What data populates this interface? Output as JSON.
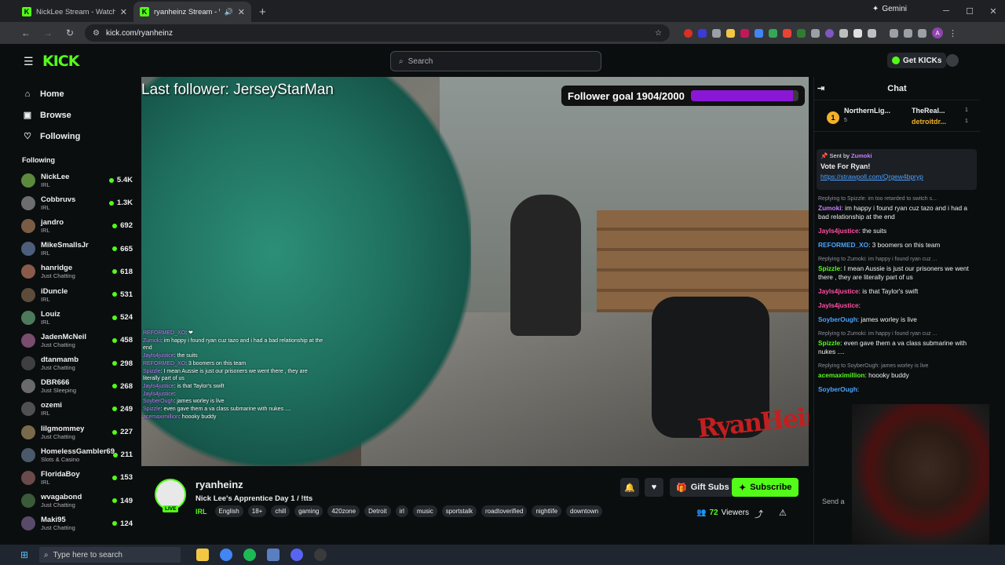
{
  "browser": {
    "tabs": [
      {
        "title": "NickLee Stream - Watch Live on",
        "active": false
      },
      {
        "title": "ryanheinz Stream - Watch L",
        "active": true
      }
    ],
    "gemini_label": "Gemini",
    "url": "kick.com/ryanheinz"
  },
  "header": {
    "logo": "KICK",
    "search_placeholder": "Search",
    "get_kicks": "Get KICKs"
  },
  "sidebar": {
    "nav": [
      {
        "label": "Home",
        "icon": "home-icon"
      },
      {
        "label": "Browse",
        "icon": "browse-icon"
      },
      {
        "label": "Following",
        "icon": "heart-icon"
      }
    ],
    "following_title": "Following",
    "channels": [
      {
        "name": "NickLee",
        "category": "IRL",
        "viewers": "5.4K"
      },
      {
        "name": "Cobbruvs",
        "category": "IRL",
        "viewers": "1.3K"
      },
      {
        "name": "jandro",
        "category": "IRL",
        "viewers": "692"
      },
      {
        "name": "MikeSmallsJr",
        "category": "IRL",
        "viewers": "665"
      },
      {
        "name": "hanridge",
        "category": "Just Chatting",
        "viewers": "618"
      },
      {
        "name": "iDuncle",
        "category": "IRL",
        "viewers": "531"
      },
      {
        "name": "Louiz",
        "category": "IRL",
        "viewers": "524"
      },
      {
        "name": "JadenMcNeil",
        "category": "Just Chatting",
        "viewers": "458"
      },
      {
        "name": "dtanmamb",
        "category": "Just Chatting",
        "viewers": "298"
      },
      {
        "name": "DBR666",
        "category": "Just Sleeping",
        "viewers": "268"
      },
      {
        "name": "ozemi",
        "category": "IRL",
        "viewers": "249"
      },
      {
        "name": "lilgmommey",
        "category": "Just Chatting",
        "viewers": "227"
      },
      {
        "name": "HomelessGambler69",
        "category": "Slots & Casino",
        "viewers": "211"
      },
      {
        "name": "FloridaBoy",
        "category": "IRL",
        "viewers": "153"
      },
      {
        "name": "wvagabond",
        "category": "Just Chatting",
        "viewers": "149"
      },
      {
        "name": "Maki95",
        "category": "Just Chatting",
        "viewers": "124"
      }
    ]
  },
  "video": {
    "last_follower": "Last follower: JerseyStarMan",
    "follower_goal": "Follower goal 1904/2000",
    "goal_progress": 0.952,
    "watermark": "RyanHeinz",
    "overlay_chat": [
      {
        "user": "REFORMED_XO",
        "text": "❤"
      },
      {
        "user": "Zumoki",
        "text": "im happy i found ryan cuz tazo and i had a bad relationship at the end"
      },
      {
        "user": "Jayls4justice",
        "text": "the suits"
      },
      {
        "user": "REFORMED_XO",
        "text": "3 boomers on this team"
      },
      {
        "user": "Spizzle",
        "text": "I mean Aussie is just our prisoners we went there , they are literally part of us"
      },
      {
        "user": "Jayls4justice",
        "text": "is that Taylor's swift"
      },
      {
        "user": "Jayls4justice",
        "text": ""
      },
      {
        "user": "SoyberOugh",
        "text": "james worley is live"
      },
      {
        "user": "Spizzle",
        "text": "even gave them a va class submarine with nukes ...."
      },
      {
        "user": "acemaximillion",
        "text": "hoooky buddy"
      }
    ]
  },
  "streamer": {
    "name": "ryanheinz",
    "title": "Nick Lee's Apprentice Day 1 / !tts",
    "live_badge": "LIVE",
    "category": "IRL",
    "tags": [
      "English",
      "18+",
      "chill",
      "gaming",
      "420zone",
      "Detroit",
      "irl",
      "music",
      "sportstalk",
      "roadtoverified",
      "nightlife",
      "downtown"
    ],
    "gift_label": "Gift Subs",
    "subscribe_label": "Subscribe",
    "viewers": "72",
    "viewers_label": "Viewers"
  },
  "chat": {
    "title": "Chat",
    "leaders": [
      {
        "name": "NorthernLig...",
        "sub": "5",
        "rank": "1"
      },
      {
        "name": "TheReal...",
        "sub": "1"
      },
      {
        "name": "detroitdr...",
        "sub": "1"
      }
    ],
    "pinned": {
      "sent_by": "Sent by",
      "user": "Zumoki",
      "vote": "Vote For Ryan!",
      "link": "https://strawpoll.com/Qrgew4bpryp"
    },
    "messages": [
      {
        "reply": "Replying to Spizzle: im too retarded to switch s...",
        "user": "Zumoki",
        "color": "#c77dff",
        "text": "im happy i found ryan cuz tazo and i had a bad relationship at the end"
      },
      {
        "reply": "",
        "user": "Jayls4justice",
        "color": "#ff4fa3",
        "text": "the suits"
      },
      {
        "reply": "",
        "user": "REFORMED_XO",
        "color": "#4aa3ff",
        "text": "3 boomers on this team"
      },
      {
        "reply": "Replying to Zumoki: im happy i found ryan cuz ...",
        "user": "Spizzle",
        "color": "#53fc18",
        "text": "I mean Aussie is just our prisoners we went there , they are literally part of us"
      },
      {
        "reply": "",
        "user": "Jayls4justice",
        "color": "#ff4fa3",
        "text": "is that Taylor's swift"
      },
      {
        "reply": "",
        "user": "Jayls4justice",
        "color": "#ff4fa3",
        "text": ""
      },
      {
        "reply": "",
        "user": "SoyberOugh",
        "color": "#4aa3ff",
        "text": "james worley is live"
      },
      {
        "reply": "Replying to Zumoki: im happy i found ryan cuz ...",
        "user": "Spizzle",
        "color": "#53fc18",
        "text": "even gave them a va class submarine with nukes ...."
      },
      {
        "reply": "Replying to SoyberOugh: james worley is live",
        "user": "acemaximillion",
        "color": "#53fc18",
        "text": "hoooky buddy"
      },
      {
        "reply": "",
        "user": "SoyberOugh",
        "color": "#4aa3ff",
        "text": ""
      }
    ],
    "send_placeholder": "Send a"
  },
  "taskbar": {
    "search_placeholder": "Type here to search"
  },
  "colors": {
    "kick_green": "#53fc18",
    "goal_purple": "#8a17d6",
    "background": "#0b0e0f"
  }
}
